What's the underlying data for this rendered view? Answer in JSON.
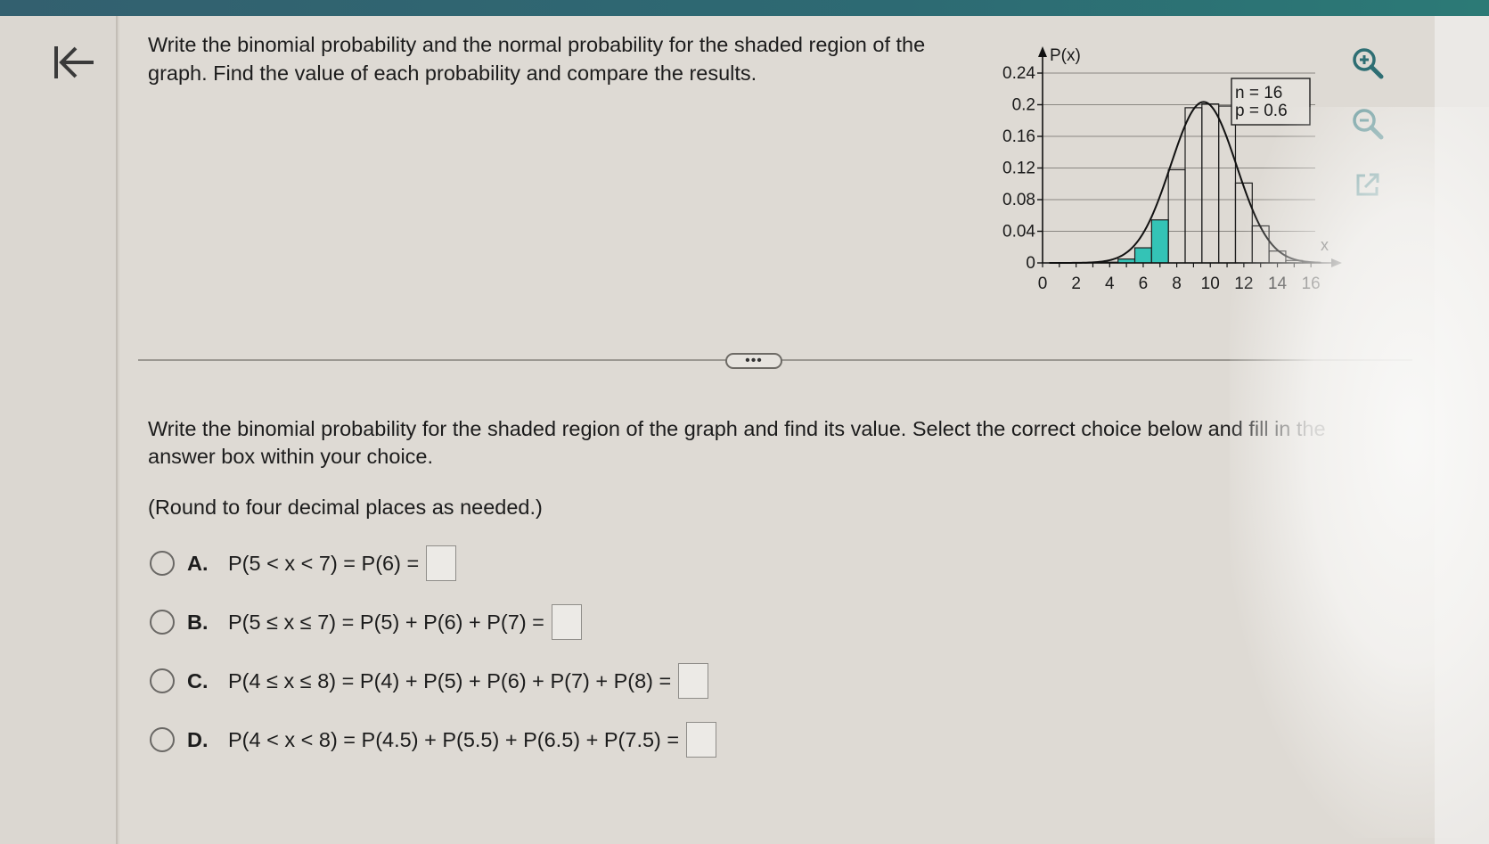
{
  "question": {
    "text": "Write the binomial probability and the normal probability for the shaded region of the graph. Find the value of each probability and compare the results."
  },
  "prompt": {
    "text": "Write the binomial probability for the shaded region of the graph and find its value. Select the correct choice below and fill in the answer box within your choice.",
    "round_note": "(Round to four decimal places as needed.)"
  },
  "choices": [
    {
      "letter": "A.",
      "expr": "P(5 < x < 7) = P(6) ="
    },
    {
      "letter": "B.",
      "expr": "P(5 ≤ x ≤ 7) = P(5) + P(6) + P(7) ="
    },
    {
      "letter": "C.",
      "expr": "P(4 ≤ x ≤ 8) = P(4) + P(5) + P(6) + P(7) + P(8) ="
    },
    {
      "letter": "D.",
      "expr": "P(4 < x < 8) = P(4.5) + P(5.5) + P(6.5) + P(7.5) ="
    }
  ],
  "icons": {
    "back": "back-to-start-icon",
    "zoom_in": "zoom-in-icon",
    "zoom_out": "zoom-out-icon",
    "popout": "popout-icon"
  },
  "colors": {
    "shade": "#34c3b6",
    "accent": "#2d6a73"
  },
  "chart_data": {
    "type": "bar",
    "ylabel": "P(x)",
    "xlabel": "x",
    "legend": [
      "n = 16",
      "p = 0.6"
    ],
    "legend_placement": "top-right",
    "x": [
      0,
      1,
      2,
      3,
      4,
      5,
      6,
      7,
      8,
      9,
      10,
      11,
      12,
      13,
      14,
      15,
      16
    ],
    "values": [
      0.0,
      0.0,
      0.0,
      0.0001,
      0.0009,
      0.0049,
      0.0191,
      0.0544,
      0.1178,
      0.1962,
      0.201,
      0.1983,
      0.101,
      0.0468,
      0.015,
      0.003,
      0.0003
    ],
    "shaded_x": [
      4,
      5,
      6,
      7
    ],
    "xticks": [
      0,
      2,
      4,
      6,
      8,
      10,
      12,
      14,
      16
    ],
    "yticks": [
      "0",
      "0.04",
      "0.08",
      "0.12",
      "0.16",
      "0.2",
      "0.24"
    ],
    "ytick_values": [
      0,
      0.04,
      0.08,
      0.12,
      0.16,
      0.2,
      0.24
    ],
    "xlim": [
      0,
      17
    ],
    "ylim": [
      0,
      0.24
    ],
    "grid": true,
    "normal_curve": {
      "mean": 9.6,
      "sd": 1.96
    }
  }
}
